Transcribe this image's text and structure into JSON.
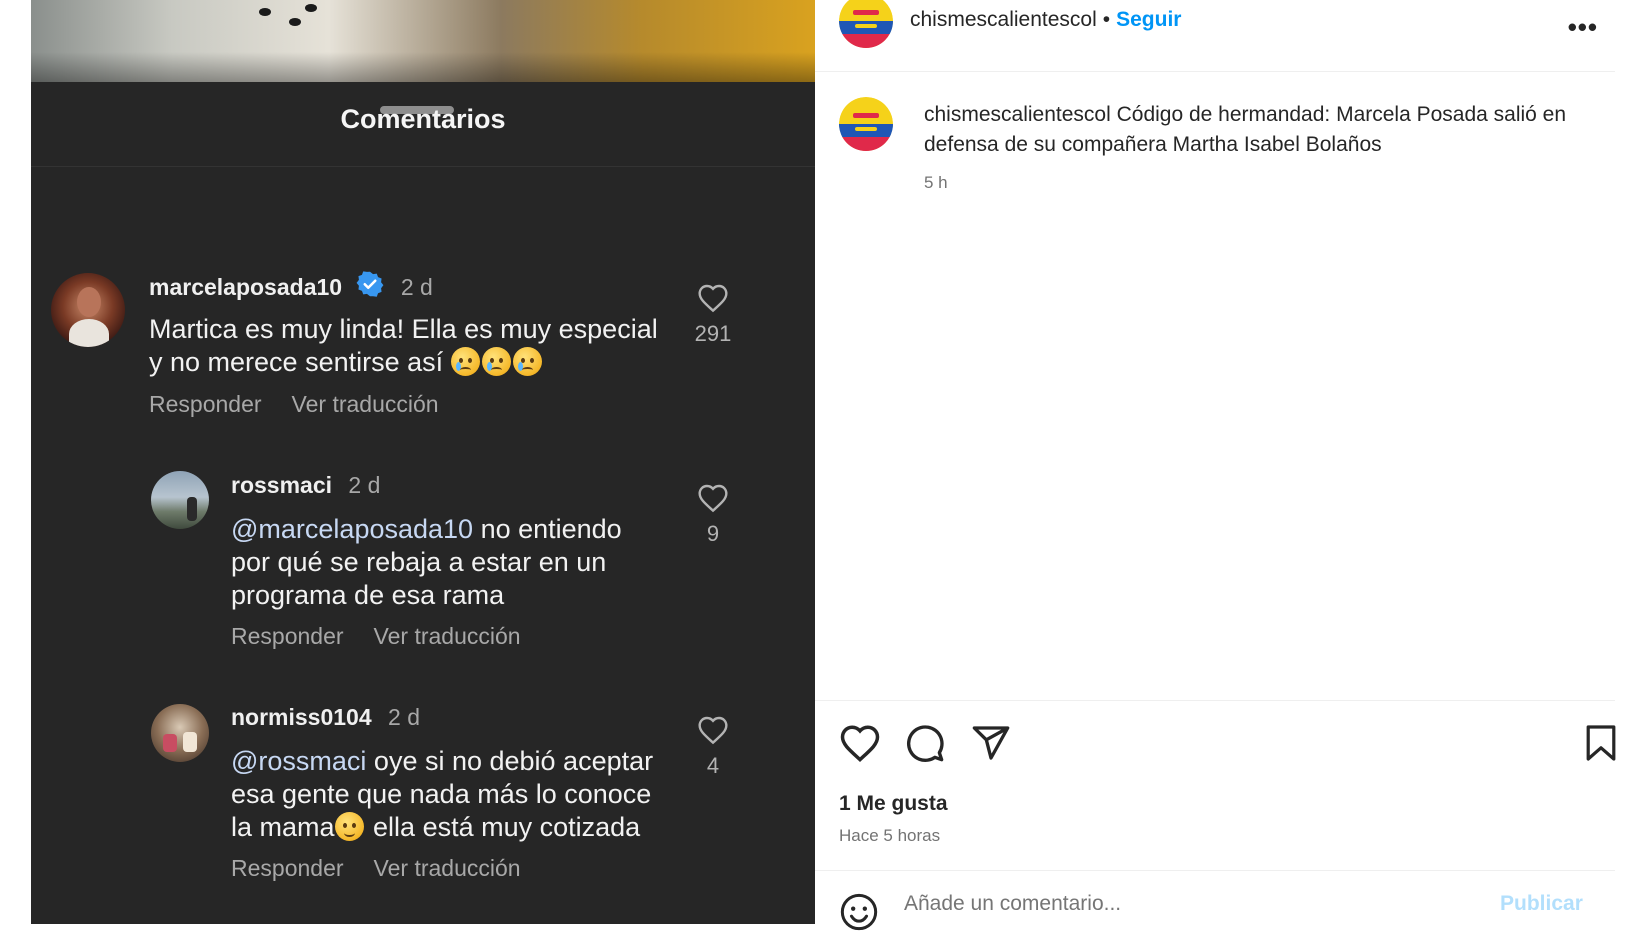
{
  "comments_panel": {
    "title": "Comentarios",
    "comments": [
      {
        "username": "marcelaposada10",
        "verified": true,
        "time": "2 d",
        "text_line1": "Martica es muy linda! Ella es muy especial",
        "text_line2": "y no merece sentirse así",
        "likes": "291",
        "reply_label": "Responder",
        "translate_label": "Ver traducción"
      },
      {
        "username": "rossmaci",
        "time": "2 d",
        "mention": "@marcelaposada10",
        "text_line1": " no entiendo",
        "text_line2": "por qué se rebaja a estar en un",
        "text_line3": "programa de esa rama",
        "likes": "9",
        "reply_label": "Responder",
        "translate_label": "Ver traducción"
      },
      {
        "username": "normiss0104",
        "time": "2 d",
        "mention": "@rossmaci",
        "text_line1": " oye si no debió aceptar",
        "text_line2": "esa gente que nada más lo conoce",
        "text_line3a": "la mama",
        "text_line3b": " ella está muy cotizada",
        "likes": "4",
        "reply_label": "Responder",
        "translate_label": "Ver traducción"
      }
    ]
  },
  "post": {
    "account": "chismescalientescol",
    "separator": "•",
    "follow_label": "Seguir",
    "more_label": "•••",
    "caption_user": "chismescalientescol",
    "caption_text": "Código de hermandad: Marcela Posada salió en defensa de su compañera Martha Isabel Bolaños",
    "caption_time": "5 h",
    "likes_text": "1 Me gusta",
    "posted_text": "Hace 5 horas",
    "comment_placeholder": "Añade un comentario...",
    "publish_label": "Publicar",
    "colors": {
      "follow": "#0095f6",
      "publish_disabled": "#b2dffc",
      "dark_sheet": "#262626"
    },
    "icons": [
      "heart-icon",
      "comment-icon",
      "share-icon",
      "bookmark-icon",
      "emoji-icon"
    ]
  }
}
